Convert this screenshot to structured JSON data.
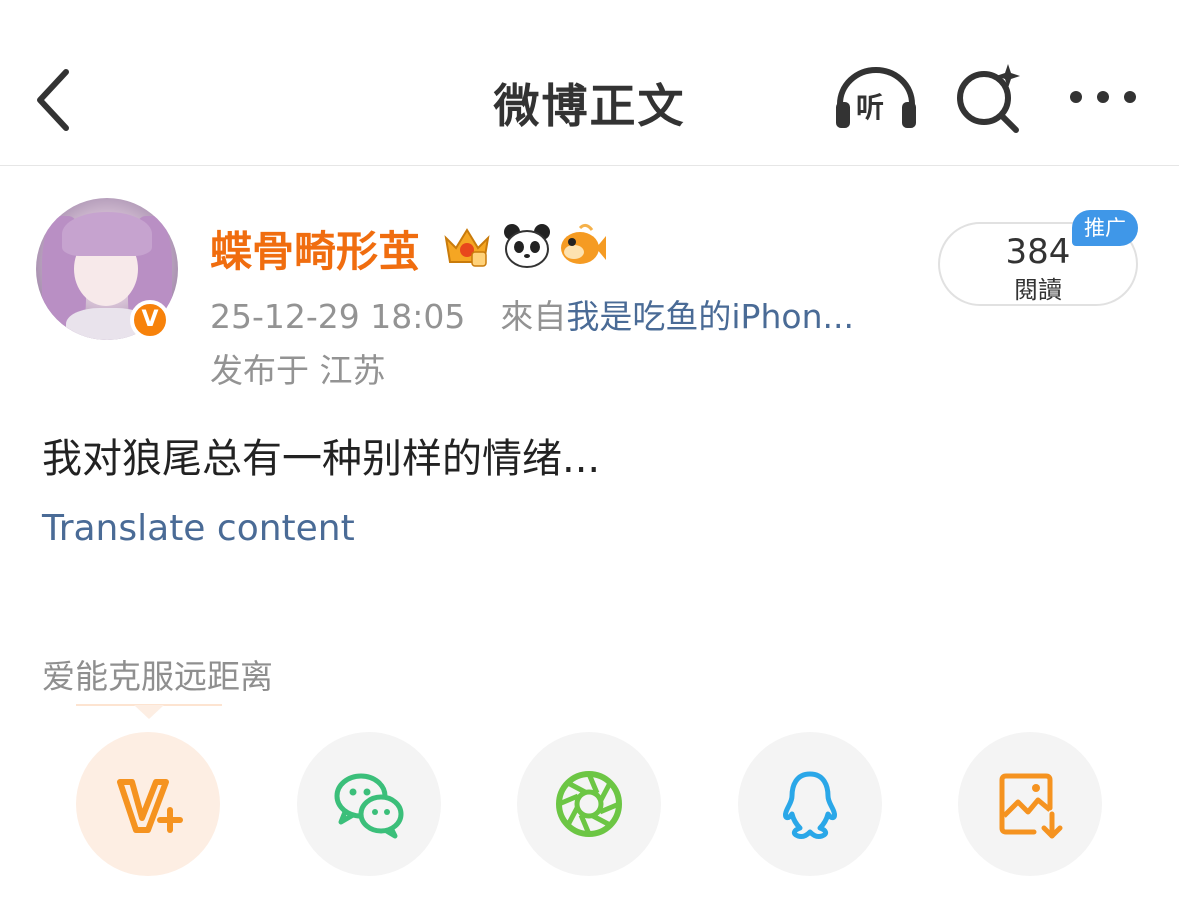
{
  "nav": {
    "title": "微博正文",
    "listen_label": "听",
    "icons": [
      "back-arrow-icon",
      "headphones-icon",
      "ai-search-icon",
      "more-icon"
    ]
  },
  "post": {
    "username": "蝶骨畸形茧",
    "badges": [
      "crown-badge-icon",
      "panda-emoji-icon",
      "fish-emoji-icon"
    ],
    "time": "25-12-29 18:05",
    "source_prefix": "來自",
    "source": "我是吃鱼的iPhon...",
    "location": "发布于 江苏",
    "reads": {
      "count": "384",
      "label": "閱讀",
      "promo": "推广"
    },
    "text": "我对狼尾总有一种别样的情绪...",
    "translate": "Translate content"
  },
  "share": {
    "title": "爱能克服远距离",
    "targets": [
      "weibo-vplus-icon",
      "wechat-icon",
      "moments-icon",
      "qq-icon",
      "save-image-icon"
    ]
  },
  "colors": {
    "username": "#f06d0f",
    "link": "#4a6b96",
    "meta": "#939393",
    "promo": "#3f97e8",
    "vbadge": "#f7820b"
  }
}
